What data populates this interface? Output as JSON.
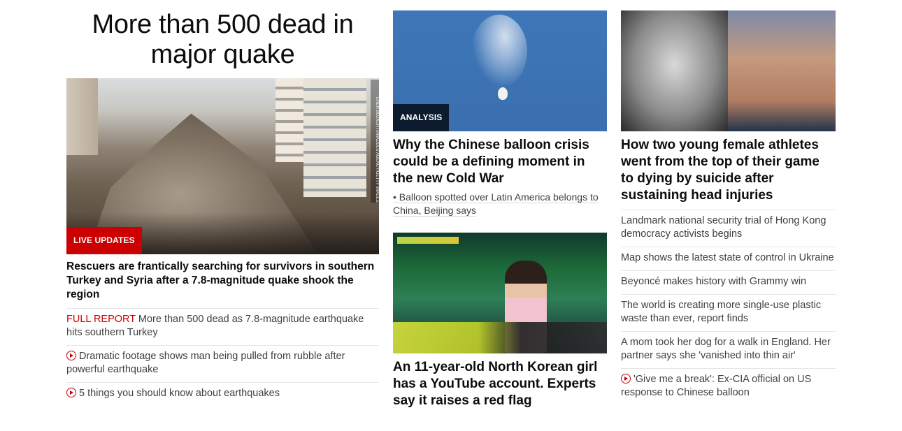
{
  "col1": {
    "headline": "More than 500 dead in major quake",
    "image_credit": "EREN BOZKURT/ANADOLU AGENCY/GETTY IMAGES",
    "tag": "LIVE UPDATES",
    "lead": "Rescuers are frantically searching for survivors in southern Turkey and Syria after a 7.8-magnitude quake shook the region",
    "links": [
      {
        "kicker": "FULL REPORT",
        "text": "More than 500 dead as 7.8-magnitude earthquake hits southern Turkey",
        "video": false
      },
      {
        "kicker": "",
        "text": "Dramatic footage shows man being pulled from rubble after powerful earthquake",
        "video": true
      },
      {
        "kicker": "",
        "text": "5 things you should know about earthquakes",
        "video": true
      }
    ]
  },
  "col2": {
    "story1": {
      "tag": "ANALYSIS",
      "headline": "Why the Chinese balloon crisis could be a defining moment in the new Cold War",
      "sublink": "• Balloon spotted over Latin America belongs to China, Beijing says"
    },
    "story2": {
      "sign": "YUMI TOUR SERIES",
      "headline": "An 11-year-old North Korean girl has a YouTube account. Experts say it raises a red flag"
    }
  },
  "col3": {
    "headline": "How two young female athletes went from the top of their game to dying by suicide after sustaining head injuries",
    "links": [
      {
        "text": "Landmark national security trial of Hong Kong democracy activists begins",
        "video": false
      },
      {
        "text": "Map shows the latest state of control in Ukraine",
        "video": false
      },
      {
        "text": "Beyoncé makes history with Grammy win",
        "video": false
      },
      {
        "text": "The world is creating more single-use plastic waste than ever, report finds",
        "video": false
      },
      {
        "text": "A mom took her dog for a walk in England. Her partner says she 'vanished into thin air'",
        "video": false
      },
      {
        "text": "'Give me a break': Ex-CIA official on US response to Chinese balloon",
        "video": true
      }
    ]
  },
  "colors": {
    "accent_red": "#cc0000",
    "analysis_navy": "#0c1b2e",
    "text": "#0c0c0c",
    "link_text": "#404040",
    "divider": "#e6e6e6"
  }
}
